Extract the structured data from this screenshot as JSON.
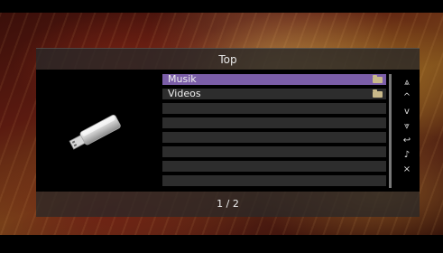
{
  "header": {
    "title": "Top"
  },
  "list": {
    "items": [
      {
        "label": "Musik",
        "type": "folder",
        "selected": true
      },
      {
        "label": "Videos",
        "type": "folder",
        "selected": false
      },
      {
        "label": ""
      },
      {
        "label": ""
      },
      {
        "label": ""
      },
      {
        "label": ""
      },
      {
        "label": ""
      },
      {
        "label": ""
      }
    ]
  },
  "controls": {
    "page_up": "⩓",
    "up": "^",
    "down": "v",
    "page_down": "⩔",
    "return": "↩",
    "now_playing": "♪",
    "close": "×"
  },
  "footer": {
    "page": "1 / 2"
  },
  "colors": {
    "selected": "#7b5ea8",
    "row": "#2d2d2d",
    "folder": "#c9b98a"
  },
  "device_icon": "usb-drive-icon"
}
